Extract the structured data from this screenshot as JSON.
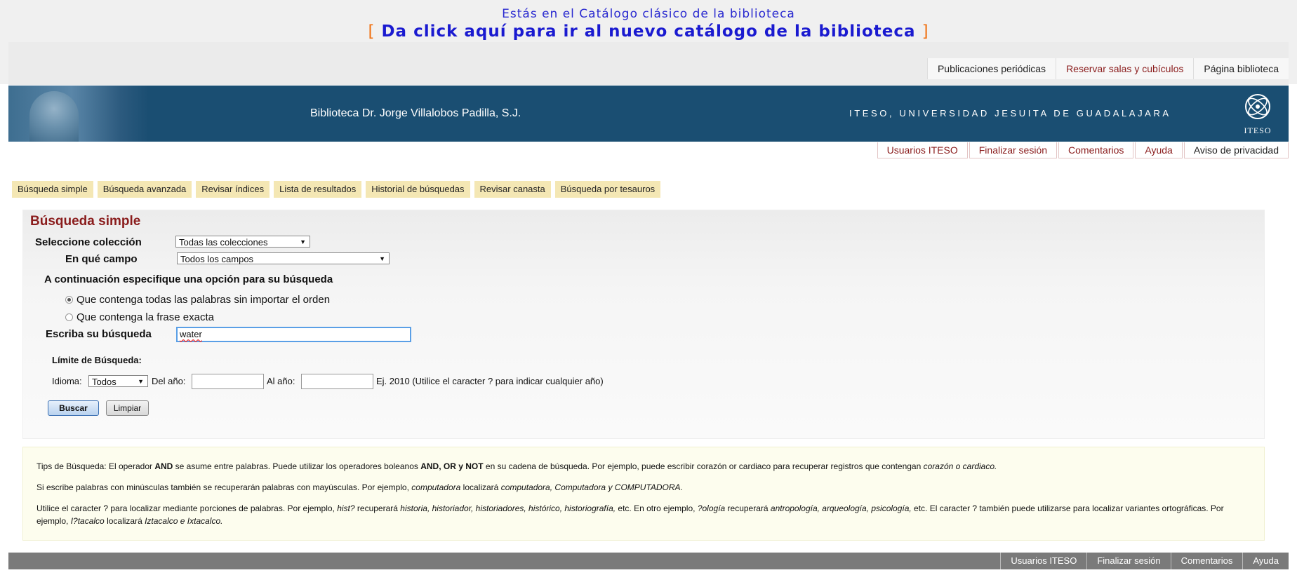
{
  "notice": {
    "line1": "Estás en el Catálogo clásico de la biblioteca",
    "bracket_open": "[",
    "link": "Da click aquí para ir al nuevo catálogo de la biblioteca",
    "bracket_close": "]"
  },
  "top_links": [
    "Publicaciones periódicas",
    "Reservar salas y cubículos",
    "Página biblioteca"
  ],
  "banner": {
    "title": "Biblioteca Dr. Jorge Villalobos Padilla, S.J.",
    "university": "ITESO, UNIVERSIDAD JESUITA DE GUADALAJARA",
    "logo_text": "ITESO"
  },
  "session_links": [
    "Usuarios ITESO",
    "Finalizar sesión",
    "Comentarios",
    "Ayuda",
    "Aviso de privacidad"
  ],
  "tabs": [
    "Búsqueda simple",
    "Búsqueda avanzada",
    "Revisar índices",
    "Lista de resultados",
    "Historial de búsquedas",
    "Revisar canasta",
    "Búsqueda por tesauros"
  ],
  "form": {
    "title": "Búsqueda simple",
    "collection_label": "Seleccione colección",
    "collection_value": "Todas las colecciones",
    "field_label": "En qué campo",
    "field_value": "Todos los campos",
    "option_heading": "A continuación especifique una opción para su búsqueda",
    "radio_all": "Que contenga todas las palabras sin importar el orden",
    "radio_exact": "Que contenga la frase exacta",
    "query_label": "Escriba su búsqueda",
    "query_value": "water",
    "limit_label": "Límite de Búsqueda:",
    "language_label": "Idioma:",
    "language_value": "Todos",
    "from_label": "Del año:",
    "to_label": "Al año:",
    "year_hint": "Ej. 2010 (Utilice el caracter ? para indicar cualquier año)",
    "search_button": "Buscar",
    "clear_button": "Limpiar"
  },
  "tips": {
    "t1": "Tips de Búsqueda: El operador ",
    "t1_and": "AND",
    "t1_b": " se asume entre palabras. Puede utilizar los operadores boleanos ",
    "t1_ops": "AND, OR y NOT",
    "t1_c": " en su cadena de búsqueda. Por ejemplo, puede escribir corazón or cardiaco para recuperar registros que contengan ",
    "t1_em": "corazón o cardiaco.",
    "t2_a": "Si escribe palabras con minúsculas también se recuperarán palabras con mayúsculas. Por ejemplo, ",
    "t2_em1": "computadora",
    "t2_b": " localizará ",
    "t2_em2": "computadora, Computadora y COMPUTADORA.",
    "t3_a": "Utilice el caracter ? para localizar mediante porciones de palabras. Por ejemplo, ",
    "t3_em1": "hist?",
    "t3_b": " recuperará ",
    "t3_em2": "historia, historiador, historiadores, histórico, historiografía,",
    "t3_c": " etc. En otro ejemplo, ",
    "t3_em3": "?ología",
    "t3_d": " recuperará ",
    "t3_em4": "antropología, arqueología, psicología,",
    "t3_e": " etc. El caracter ? también puede utilizarse para localizar variantes ortográficas. Por ejemplo, ",
    "t3_em5": "I?tacalco",
    "t3_f": " localizará ",
    "t3_em6": "Iztacalco e Ixtacalco."
  },
  "footer_links": [
    "Usuarios ITESO",
    "Finalizar sesión",
    "Comentarios",
    "Ayuda"
  ]
}
